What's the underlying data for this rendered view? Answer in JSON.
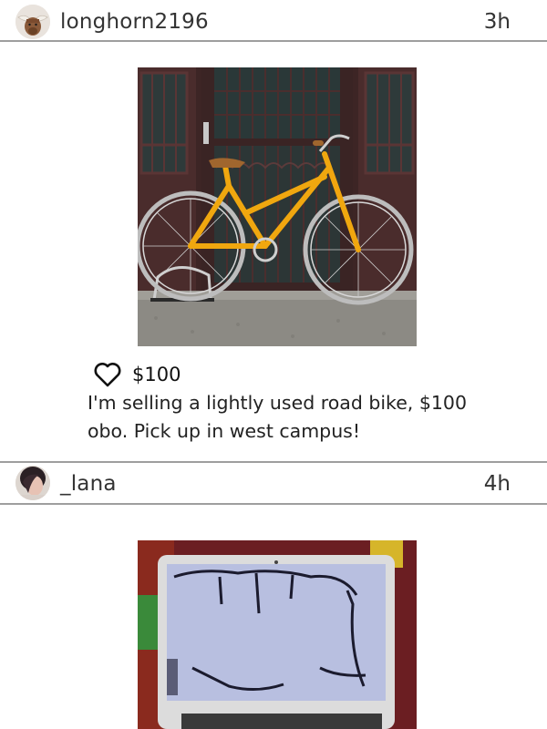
{
  "posts": [
    {
      "username": "longhorn2196",
      "time": "3h",
      "avatar_icon": "longhorn-cow-avatar",
      "price": "$100",
      "caption": "I'm selling a lightly used road bike, $100 obo. Pick up in west campus!",
      "image_subject": "yellow-bicycle-photo"
    },
    {
      "username": "_lana",
      "time": "4h",
      "avatar_icon": "user-photo-avatar",
      "image_subject": "cracked-laptop-photo"
    }
  ],
  "colors": {
    "divider": "#9e9e9e",
    "bike_frame": "#f0a70f",
    "text": "#2b2b2b"
  }
}
